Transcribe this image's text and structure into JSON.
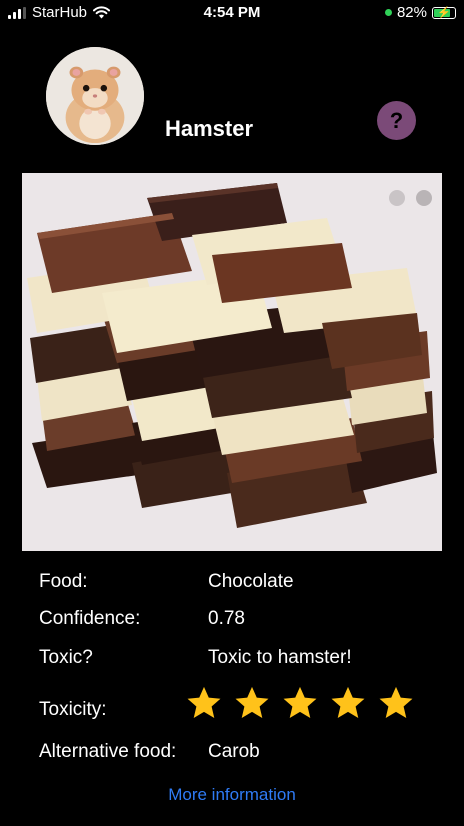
{
  "status_bar": {
    "carrier": "StarHub",
    "time": "4:54 PM",
    "battery": "82%",
    "battery_level": 0.82
  },
  "header": {
    "animal": "Hamster",
    "help_label": "?"
  },
  "result": {
    "food_label": "Food:",
    "food_value": "Chocolate",
    "confidence_label": "Confidence:",
    "confidence_value": "0.78",
    "toxic_label": "Toxic?",
    "toxic_value": "Toxic to hamster!",
    "toxicity_label": "Toxicity:",
    "toxicity_rating": 5,
    "toxicity_max": 5,
    "alternative_label": "Alternative food:",
    "alternative_value": "Carob"
  },
  "more_info_label": "More information",
  "colors": {
    "accent_link": "#2f7bf5",
    "star": "#ffc21a",
    "help_button": "#7b4a78"
  },
  "icons": [
    "signal-icon",
    "wifi-icon",
    "battery-icon",
    "help-icon",
    "star-icon"
  ]
}
